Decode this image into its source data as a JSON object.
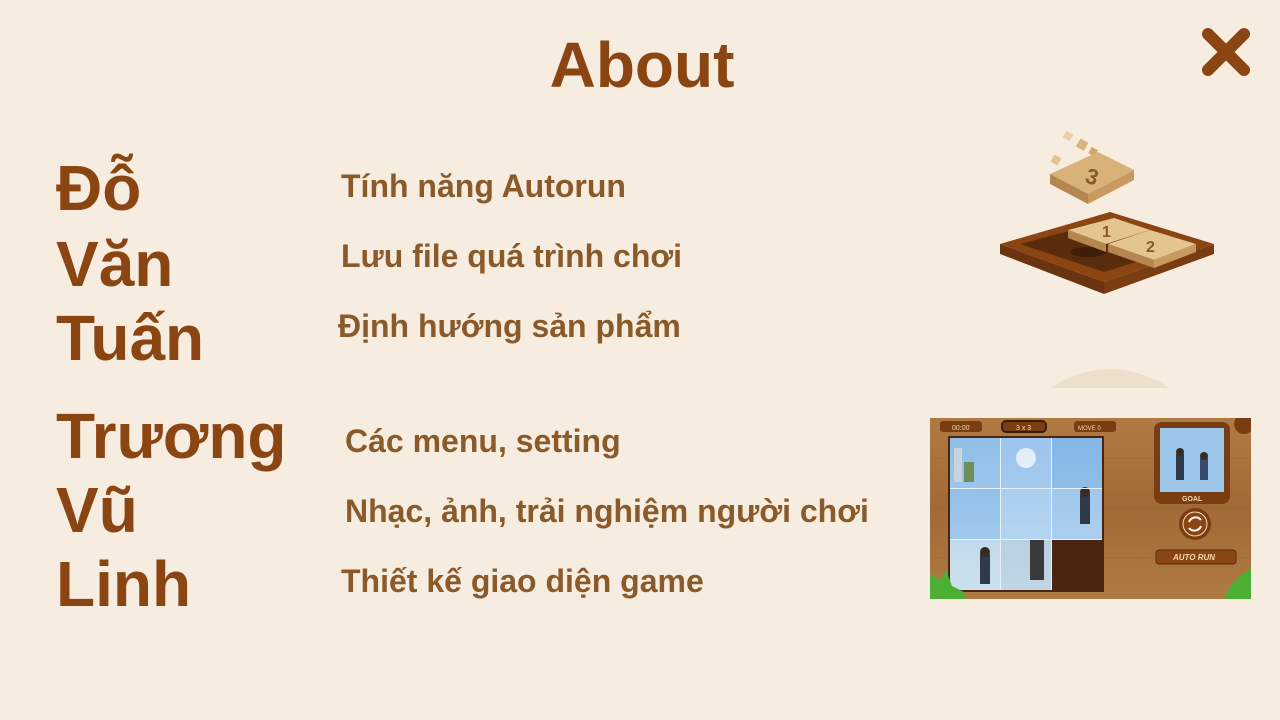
{
  "header": {
    "title": "About"
  },
  "close_icon": "close-icon",
  "members": [
    {
      "name_words": [
        "Đỗ",
        "Văn",
        "Tuấn"
      ],
      "features": [
        "Tính năng Autorun",
        "Lưu file quá trình chơi",
        "Định hướng sản phẩm"
      ]
    },
    {
      "name_words": [
        "Trương",
        "Vũ",
        "Linh"
      ],
      "features": [
        "Các menu, setting",
        "Nhạc, ảnh, trải nghiệm người chơi",
        "Thiết kế giao diện game"
      ]
    }
  ],
  "game_logo": {
    "tiles": [
      "3",
      "1",
      "2"
    ]
  },
  "game_screenshot": {
    "timer": "00:00",
    "grid_size": "3 x 3",
    "move_label": "MOVE 0",
    "goal_label": "GOAL",
    "auto_run_label": "AUTO RUN"
  },
  "colors": {
    "background": "#f6ede0",
    "title": "#8b4513",
    "feature_text": "#8b5a2b",
    "wood": "#a0622d"
  }
}
